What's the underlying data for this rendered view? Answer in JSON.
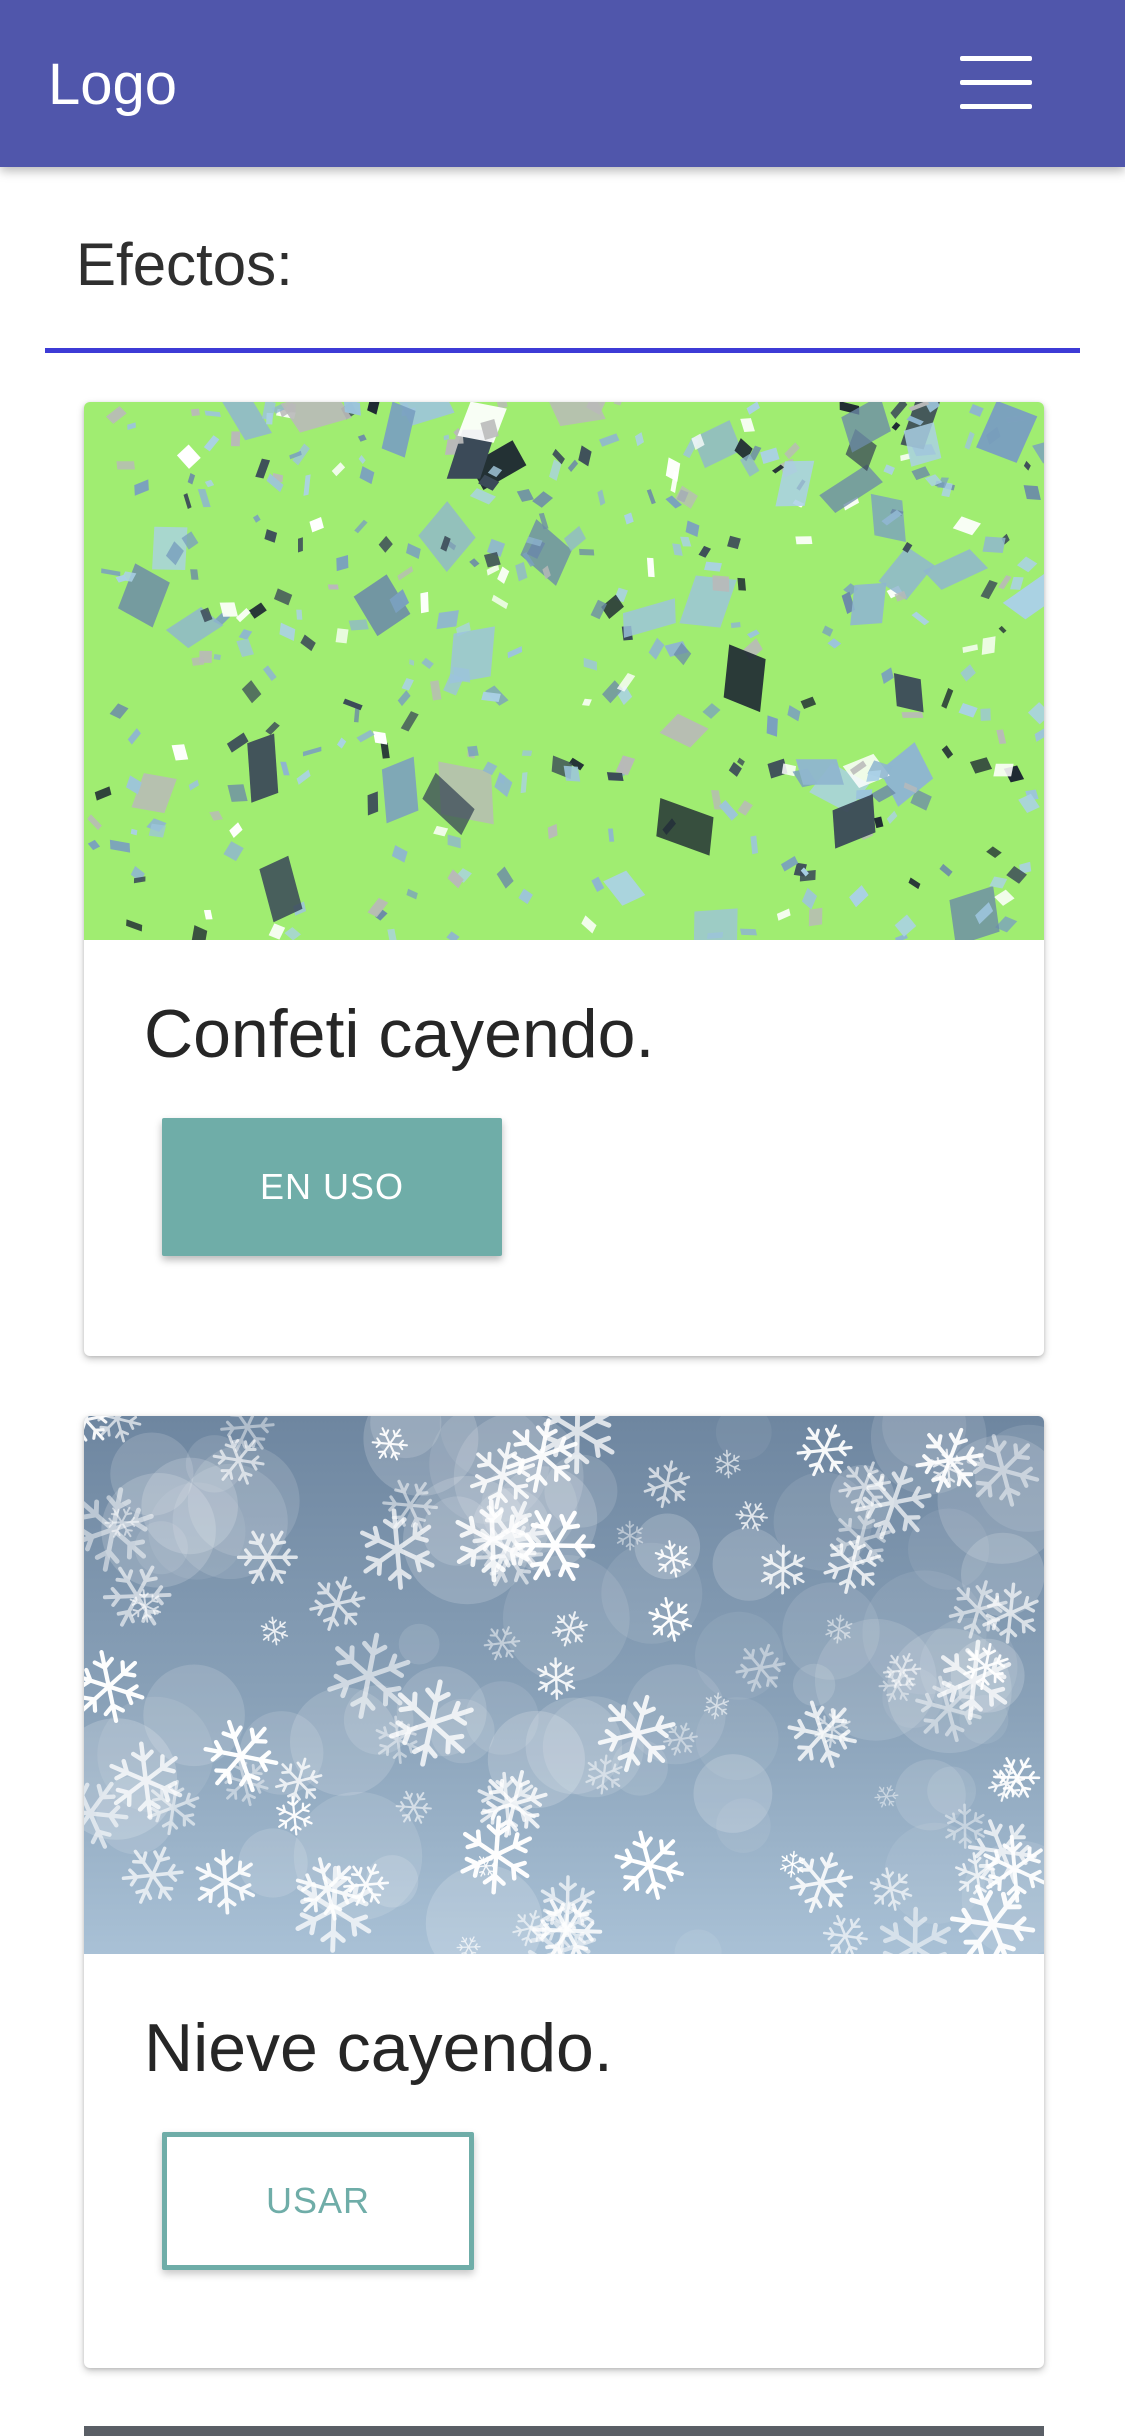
{
  "navbar": {
    "brand": "Logo",
    "menu_icon": "hamburger-menu-icon",
    "background": "#5056ab"
  },
  "section": {
    "title": "Efectos:",
    "rule_color": "#3d3bd6"
  },
  "effects": [
    {
      "title": "Confeti cayendo.",
      "button_label": "EN USO",
      "button_state": "active",
      "image": "falling-confetti-on-green",
      "image_bg": "#a0ed71"
    },
    {
      "title": "Nieve cayendo.",
      "button_label": "USAR",
      "button_state": "inactive",
      "image": "falling-snowflakes-on-blue-grey",
      "image_bg": "#7d95ad"
    }
  ],
  "colors": {
    "accent": "#6fada8",
    "text": "#262626"
  }
}
